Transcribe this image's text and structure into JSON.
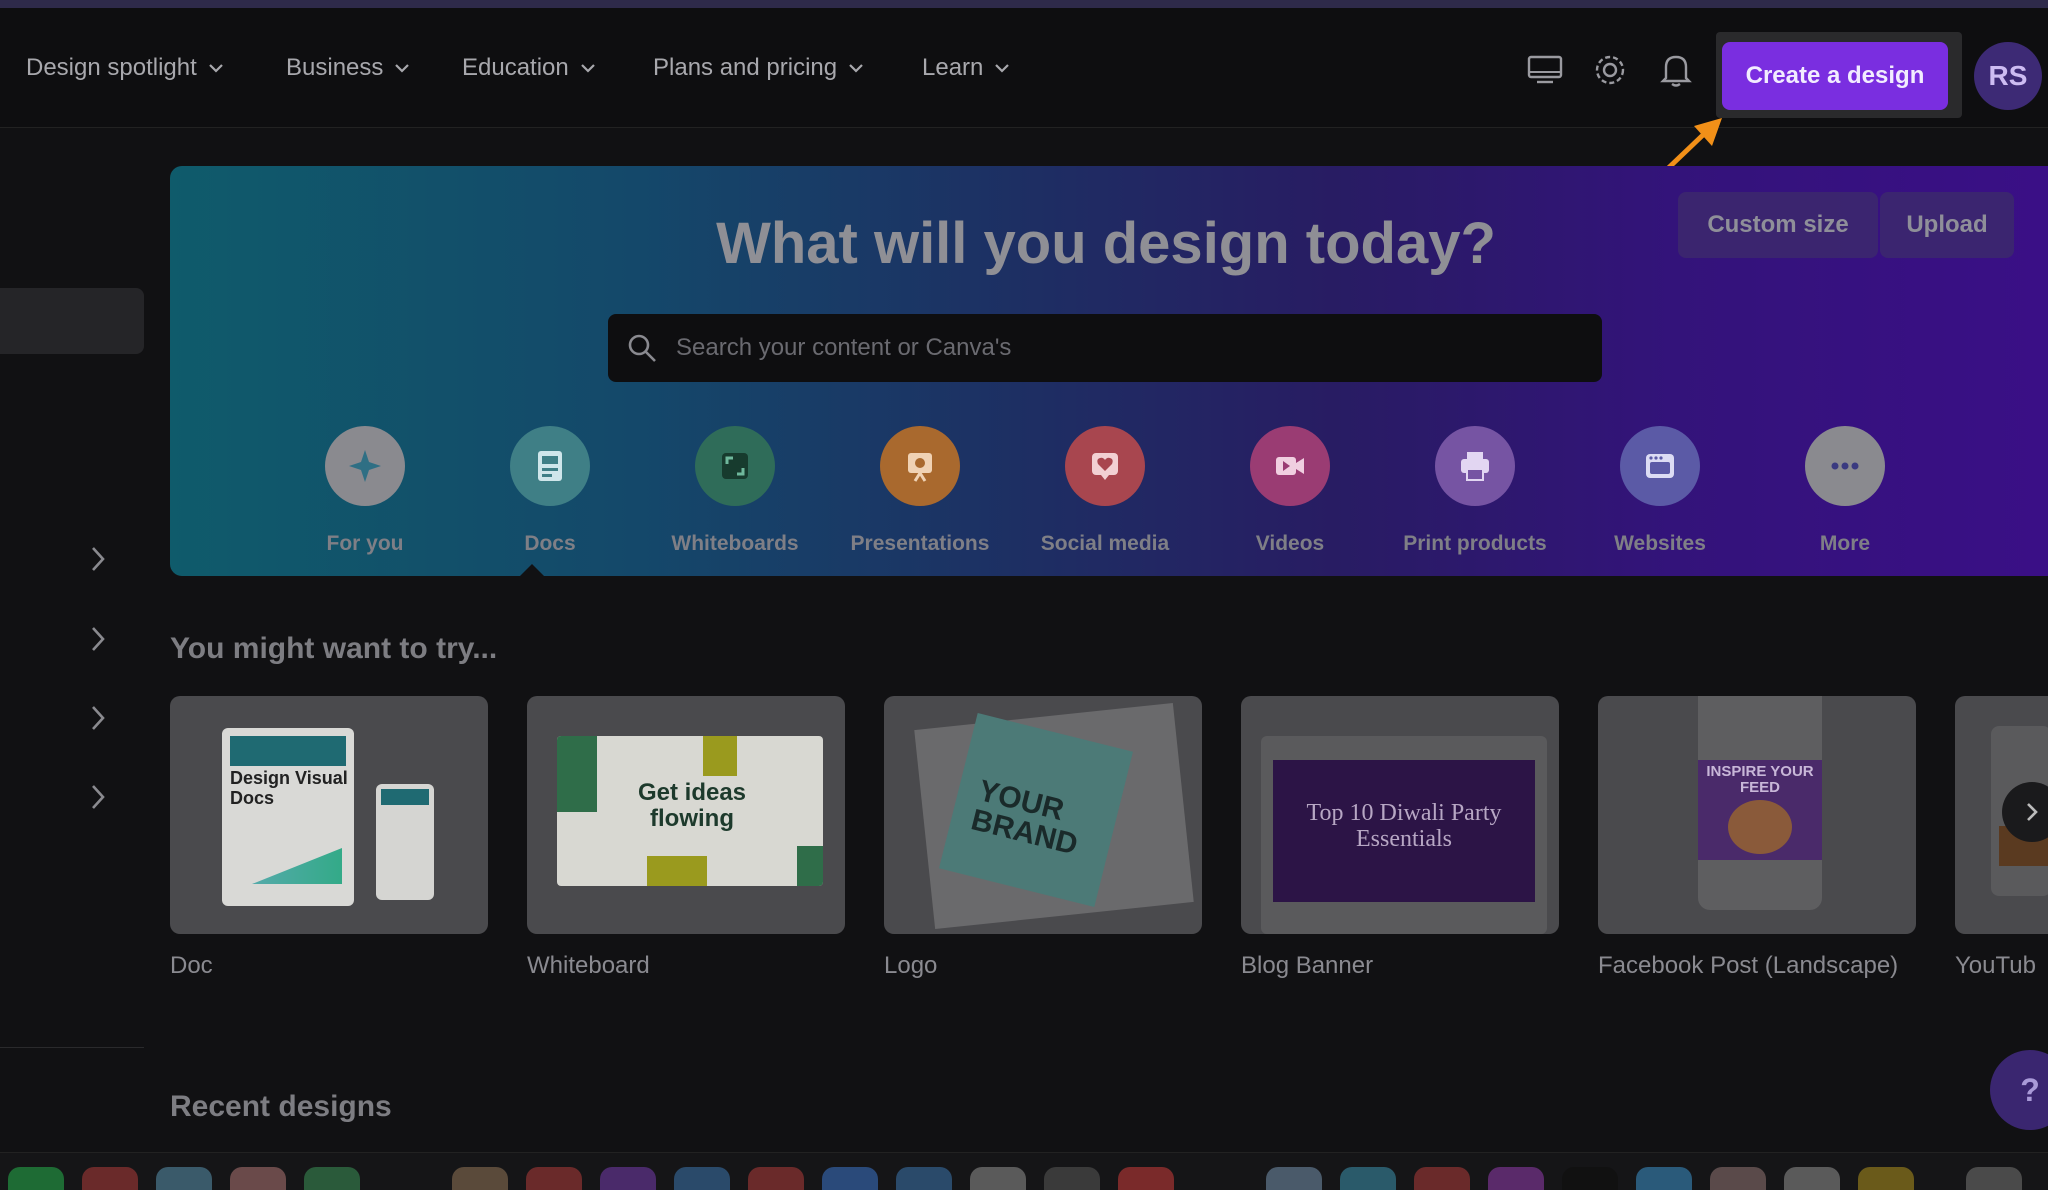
{
  "nav": {
    "items": [
      {
        "label": "Design spotlight"
      },
      {
        "label": "Business"
      },
      {
        "label": "Education"
      },
      {
        "label": "Plans and pricing"
      },
      {
        "label": "Learn"
      }
    ],
    "create_label": "Create a design",
    "avatar_initials": "RS",
    "icons": [
      "monitor-icon",
      "gear-icon",
      "bell-icon"
    ]
  },
  "hero": {
    "title": "What will you design today?",
    "custom_size_label": "Custom size",
    "upload_label": "Upload",
    "search_placeholder": "Search your content or Canva's",
    "categories": [
      {
        "label": "For you",
        "icon": "sparkle-icon",
        "color": "#8a8a8f"
      },
      {
        "label": "Docs",
        "icon": "doc-icon",
        "color": "#1a8d94"
      },
      {
        "label": "Whiteboards",
        "icon": "whiteboard-icon",
        "color": "#16805e"
      },
      {
        "label": "Presentations",
        "icon": "presentation-icon",
        "color": "#c4611b"
      },
      {
        "label": "Social media",
        "icon": "heart-icon",
        "color": "#c3313f"
      },
      {
        "label": "Videos",
        "icon": "video-icon",
        "color": "#b52a78"
      },
      {
        "label": "Print products",
        "icon": "printer-icon",
        "color": "#7b3fbb"
      },
      {
        "label": "Websites",
        "icon": "website-icon",
        "color": "#4a4ab8"
      },
      {
        "label": "More",
        "icon": "more-icon",
        "color": "#8a8a8f"
      }
    ]
  },
  "suggestions": {
    "title": "You might want to try...",
    "cards": [
      {
        "label": "Doc",
        "thumb_text": "Design Visual Docs"
      },
      {
        "label": "Whiteboard",
        "thumb_text": "Get ideas flowing"
      },
      {
        "label": "Logo",
        "thumb_text": "YOUR BRAND"
      },
      {
        "label": "Blog Banner",
        "thumb_text": "Top 10 Diwali Party Essentials"
      },
      {
        "label": "Facebook Post (Landscape)",
        "thumb_text": "INSPIRE YOUR FEED"
      },
      {
        "label": "YouTub",
        "thumb_text": ""
      }
    ]
  },
  "recent": {
    "title": "Recent designs"
  },
  "help": {
    "label": "?"
  },
  "colors": {
    "accent": "#7a2ee0",
    "arrow": "#f29018"
  }
}
